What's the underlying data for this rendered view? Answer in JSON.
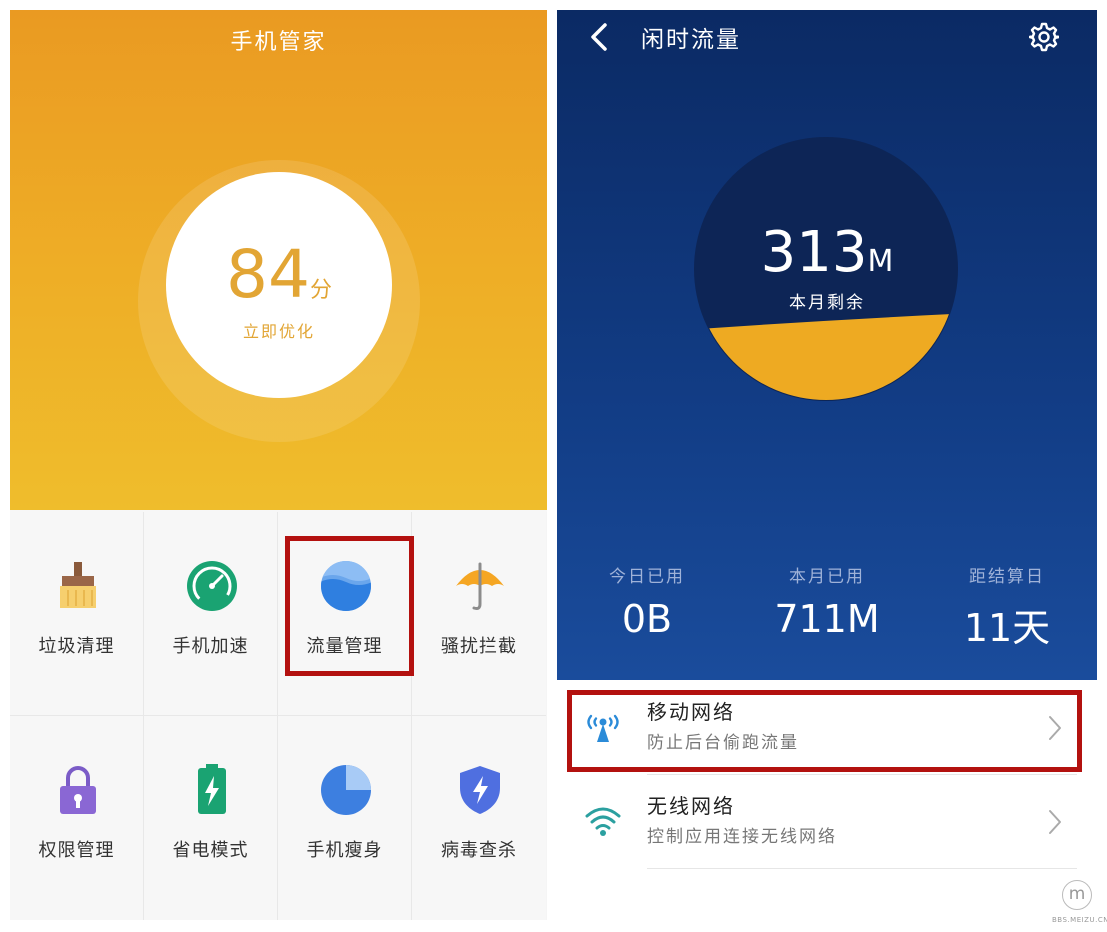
{
  "phone_manager": {
    "title": "手机管家",
    "score": {
      "value": "84",
      "unit": "分",
      "action_label": "立即优化"
    },
    "tools": [
      {
        "label": "垃圾清理",
        "icon": "broom-icon"
      },
      {
        "label": "手机加速",
        "icon": "speedometer-icon"
      },
      {
        "label": "流量管理",
        "icon": "water-ball-icon"
      },
      {
        "label": "骚扰拦截",
        "icon": "umbrella-icon"
      },
      {
        "label": "权限管理",
        "icon": "padlock-icon"
      },
      {
        "label": "省电模式",
        "icon": "battery-icon"
      },
      {
        "label": "手机瘦身",
        "icon": "pie-chart-icon"
      },
      {
        "label": "病毒查杀",
        "icon": "shield-icon"
      }
    ],
    "highlighted_tool": "流量管理"
  },
  "data_usage": {
    "title": "闲时流量",
    "remaining": {
      "value": "313",
      "unit": "M",
      "label": "本月剩余",
      "used_fraction": 0.3
    },
    "stats": [
      {
        "label": "今日已用",
        "value": "0B"
      },
      {
        "label": "本月已用",
        "value": "711M"
      },
      {
        "label": "距结算日",
        "value": "11天"
      }
    ],
    "network_items": [
      {
        "title": "移动网络",
        "subtitle": "防止后台偷跑流量",
        "icon": "cell-tower-icon"
      },
      {
        "title": "无线网络",
        "subtitle": "控制应用连接无线网络",
        "icon": "wifi-icon"
      }
    ],
    "highlighted_item": "移动网络"
  },
  "watermark": {
    "logo_letter": "m",
    "text": "BBS.MEIZU.CN"
  },
  "colors": {
    "orange_top": "#ea9a22",
    "orange_bottom": "#efbd2c",
    "navy_top": "#0b2a64",
    "navy_bottom": "#1a4c9c",
    "gauge_fill": "#eeaa22",
    "highlight_red": "#b3110f"
  }
}
